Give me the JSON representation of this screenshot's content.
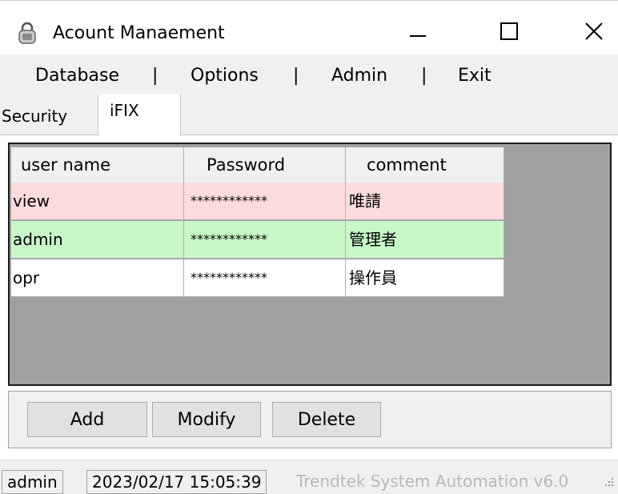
{
  "window": {
    "title": "Acount Manaement",
    "icons": {
      "app": "lock-icon",
      "minimize": "minimize-icon",
      "maximize": "maximize-icon",
      "close": "close-icon"
    }
  },
  "menu": {
    "items": [
      "Database",
      "Options",
      "Admin",
      "Exit"
    ],
    "separator": "|"
  },
  "tabs": [
    {
      "label": "Security",
      "selected": false
    },
    {
      "label": "iFIX",
      "selected": true
    }
  ],
  "grid": {
    "columns": [
      "user name",
      "Password",
      "comment"
    ],
    "rows": [
      {
        "user": "view",
        "password": "************",
        "comment": "唯請",
        "color": "#fcdcdc"
      },
      {
        "user": "admin",
        "password": "************",
        "comment": "管理者",
        "color": "#c8f8c8"
      },
      {
        "user": "opr",
        "password": "************",
        "comment": "操作員",
        "color": "#ffffff"
      }
    ],
    "empty_area_color": "#a0a0a0"
  },
  "buttons": {
    "add": "Add",
    "modify": "Modify",
    "delete": "Delete"
  },
  "status": {
    "user": "admin",
    "datetime": "2023/02/17 15:05:39",
    "brand": "Trendtek System Automation v6.0"
  }
}
